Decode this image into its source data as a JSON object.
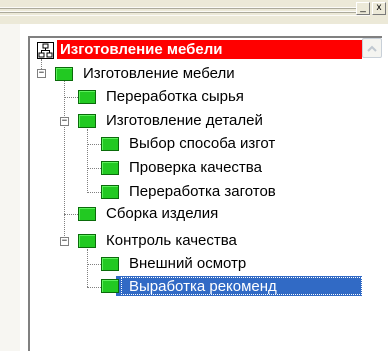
{
  "window": {
    "min_button": "_",
    "close_button": "x"
  },
  "tree": {
    "root_label": "Изготовление мебели",
    "items": [
      {
        "label": "Изготовление мебели",
        "expander": "−"
      },
      {
        "label": "Переработка сырья"
      },
      {
        "label": "Изготовление деталей",
        "expander": "−"
      },
      {
        "label": "Выбор  способа изгот"
      },
      {
        "label": "Проверка  качества"
      },
      {
        "label": "Переработка заготов"
      },
      {
        "label": "Сборка изделия"
      },
      {
        "label": "Контроль качества",
        "expander": "−"
      },
      {
        "label": "Внешний осмотр"
      },
      {
        "label": "Выработка  рекоменд"
      }
    ],
    "selected_index": 9
  },
  "colors": {
    "root_highlight": "#ff0000",
    "selection": "#316ac5",
    "node_icon": "#22c922"
  }
}
